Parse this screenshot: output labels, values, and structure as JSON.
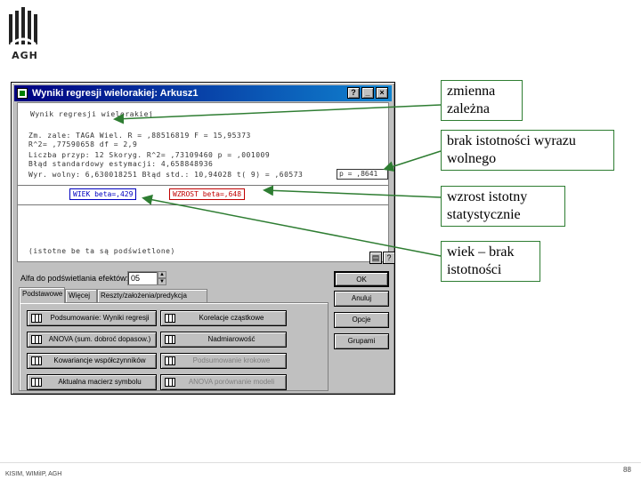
{
  "logo": {
    "text": "AGH"
  },
  "window": {
    "title": "Wyniki regresji wielorakiej: Arkusz1",
    "title_buttons": [
      "?",
      "_",
      "×"
    ]
  },
  "output": {
    "rows": [
      "Wynik  regresji wielorakiej",
      "Zm. zale: TAGA            Wiel. R =  ,88516819    F = 15,95373",
      "                          R^2=  ,77590658   df =  2,9",
      "Liczba przyp: 12          Skoryg. R^2= ,73109460    p =  ,001009",
      "      Błąd standardowy estymacji: 4,658848936",
      "Wyr. wolny: 6,630018251  Błąd std.: 10,94028  t(   9) = ,60573"
    ],
    "pvalue": "p = ,8641",
    "boxed_age": "WIEK beta=,429",
    "boxed_growth": "WZROST beta=,648",
    "bottom_line": "(istotne be ta są podświetlone)"
  },
  "controls": {
    "alpha_label": "Alfa do podświetlania efektów:",
    "alpha_value": "05",
    "tabs": [
      "Podstawowe",
      "Więcej",
      "Reszty/założenia/predykcja"
    ],
    "buttons": [
      {
        "label": "Podsumowanie: Wyniki regresji",
        "disabled": false
      },
      {
        "label": "Korelacje cząstkowe",
        "disabled": false
      },
      {
        "label": "ANOVA (sum. dobroć dopasow.)",
        "disabled": false
      },
      {
        "label": "Nadmiarowość",
        "disabled": false
      },
      {
        "label": "Kowariancje współczynników",
        "disabled": false
      },
      {
        "label": "Podsumowanie krokowe",
        "disabled": true
      },
      {
        "label": "Aktualna macierz symbolu",
        "disabled": false
      },
      {
        "label": "ANOVA porównanie modeli",
        "disabled": true
      }
    ],
    "right_buttons": {
      "ok": "OK",
      "cancel": "Anuluj",
      "options": "Opcje",
      "group": "Grupami"
    }
  },
  "annotations": {
    "dependent": "zmienna zależna",
    "intercept": "brak istotności wyrazu wolnego",
    "height": "wzrost istotny statystycznie",
    "age": "wiek – brak istotności"
  },
  "footer": {
    "left": "KISIM, WIMiIP, AGH",
    "page": "88"
  },
  "colors": {
    "title_start": "#000080",
    "title_end": "#1084d0",
    "annotation_border": "#2e7d32",
    "highlight": "#c00000"
  }
}
